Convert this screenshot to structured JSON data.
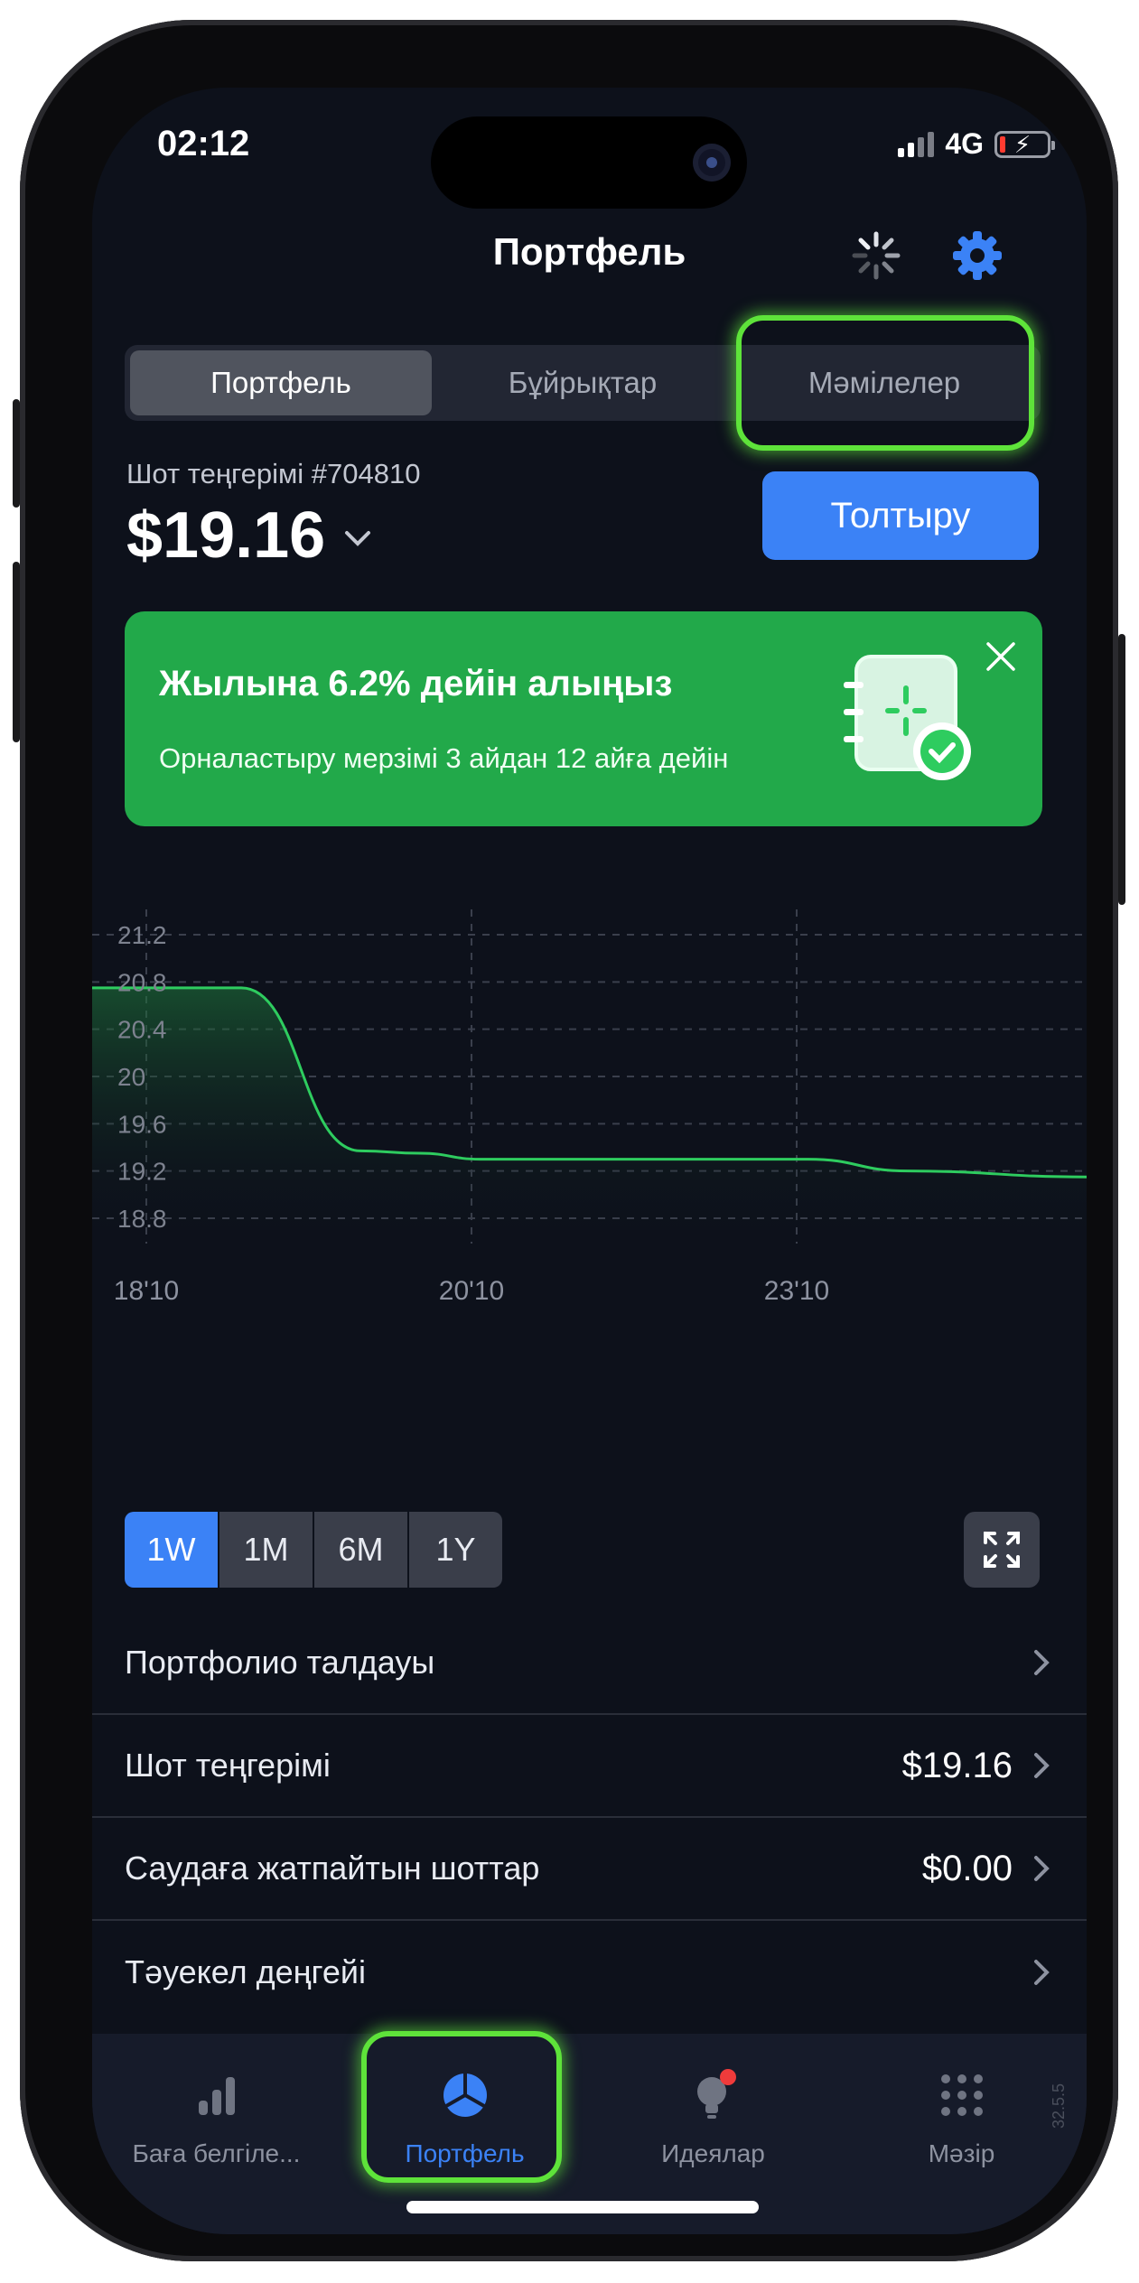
{
  "status_bar": {
    "time": "02:12",
    "network": "4G"
  },
  "header": {
    "title": "Портфель"
  },
  "segments": [
    {
      "label": "Портфель",
      "active": true
    },
    {
      "label": "Бұйрықтар",
      "active": false
    },
    {
      "label": "Мәмілелер",
      "active": false
    }
  ],
  "account": {
    "label": "Шот теңгерімі #704810",
    "balance": "$19.16",
    "topup_label": "Толтыру"
  },
  "promo": {
    "title": "Жылына 6.2% дейін алыңыз",
    "subtitle": "Орналастыру мерзімі 3 айдан 12 айға дейін"
  },
  "chart_data": {
    "type": "area",
    "y_ticks": [
      "21.2",
      "20.8",
      "20.4",
      "20",
      "19.6",
      "19.2",
      "18.8"
    ],
    "x_ticks": [
      "18'10",
      "20'10",
      "23'10"
    ],
    "ylim": [
      18.8,
      21.2
    ],
    "series": [
      {
        "x": [
          0.0,
          0.15,
          0.27,
          0.33,
          0.39,
          0.55,
          0.72,
          0.82,
          1.0
        ],
        "values": [
          20.75,
          20.75,
          19.37,
          19.35,
          19.3,
          19.3,
          19.3,
          19.2,
          19.15
        ]
      }
    ],
    "color": "#2ecc5f",
    "grid": true
  },
  "ranges": [
    {
      "label": "1W",
      "active": true
    },
    {
      "label": "1M",
      "active": false
    },
    {
      "label": "6M",
      "active": false
    },
    {
      "label": "1Y",
      "active": false
    }
  ],
  "list": [
    {
      "label": "Портфолио талдауы",
      "value": ""
    },
    {
      "label": "Шот теңгерімі",
      "value": "$19.16"
    },
    {
      "label": "Саудаға жатпайтын шоттар",
      "value": "$0.00"
    },
    {
      "label": "Тәуекел деңгейі",
      "value": ""
    }
  ],
  "tabs": [
    {
      "label": "Баға белгіле...",
      "icon": "bars-icon",
      "active": false
    },
    {
      "label": "Портфель",
      "icon": "pie-chart-icon",
      "active": true
    },
    {
      "label": "Идеялар",
      "icon": "lightbulb-icon",
      "active": false
    },
    {
      "label": "Мәзір",
      "icon": "grid-dots-icon",
      "active": false
    }
  ],
  "version": "32.5.5",
  "colors": {
    "accent": "#3b82f6",
    "promo": "#22a94a",
    "highlight": "#5ee33a",
    "background": "#0d111b"
  }
}
